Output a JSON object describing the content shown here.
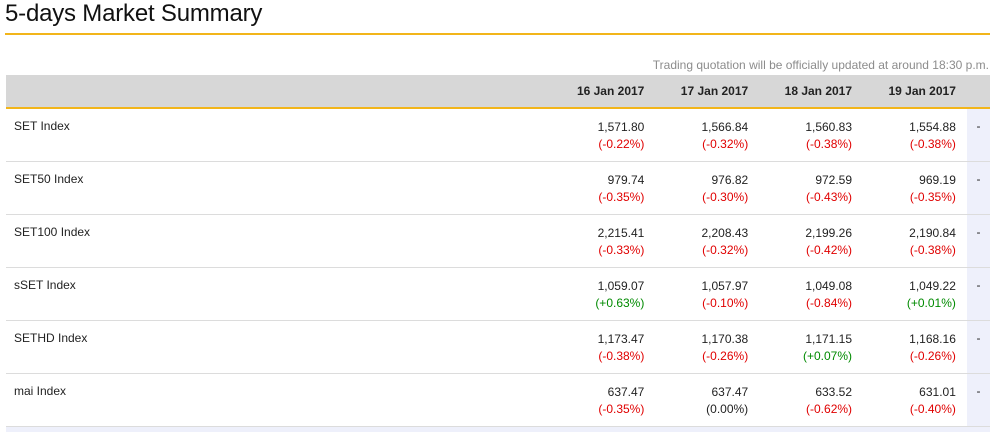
{
  "page": {
    "title": "5-days Market Summary",
    "note": "Trading quotation will be officially updated at around 18:30 p.m."
  },
  "table": {
    "dates": [
      "16 Jan 2017",
      "17 Jan 2017",
      "18 Jan 2017",
      "19 Jan 2017"
    ],
    "extra_marker": "-",
    "rows": [
      {
        "name": "SET Index",
        "values": [
          {
            "value": "1,571.80",
            "change": "(-0.22%)",
            "dir": "neg"
          },
          {
            "value": "1,566.84",
            "change": "(-0.32%)",
            "dir": "neg"
          },
          {
            "value": "1,560.83",
            "change": "(-0.38%)",
            "dir": "neg"
          },
          {
            "value": "1,554.88",
            "change": "(-0.38%)",
            "dir": "neg"
          }
        ]
      },
      {
        "name": "SET50 Index",
        "values": [
          {
            "value": "979.74",
            "change": "(-0.35%)",
            "dir": "neg"
          },
          {
            "value": "976.82",
            "change": "(-0.30%)",
            "dir": "neg"
          },
          {
            "value": "972.59",
            "change": "(-0.43%)",
            "dir": "neg"
          },
          {
            "value": "969.19",
            "change": "(-0.35%)",
            "dir": "neg"
          }
        ]
      },
      {
        "name": "SET100 Index",
        "values": [
          {
            "value": "2,215.41",
            "change": "(-0.33%)",
            "dir": "neg"
          },
          {
            "value": "2,208.43",
            "change": "(-0.32%)",
            "dir": "neg"
          },
          {
            "value": "2,199.26",
            "change": "(-0.42%)",
            "dir": "neg"
          },
          {
            "value": "2,190.84",
            "change": "(-0.38%)",
            "dir": "neg"
          }
        ]
      },
      {
        "name": "sSET Index",
        "values": [
          {
            "value": "1,059.07",
            "change": "(+0.63%)",
            "dir": "pos"
          },
          {
            "value": "1,057.97",
            "change": "(-0.10%)",
            "dir": "neg"
          },
          {
            "value": "1,049.08",
            "change": "(-0.84%)",
            "dir": "neg"
          },
          {
            "value": "1,049.22",
            "change": "(+0.01%)",
            "dir": "pos"
          }
        ]
      },
      {
        "name": "SETHD Index",
        "values": [
          {
            "value": "1,173.47",
            "change": "(-0.38%)",
            "dir": "neg"
          },
          {
            "value": "1,170.38",
            "change": "(-0.26%)",
            "dir": "neg"
          },
          {
            "value": "1,171.15",
            "change": "(+0.07%)",
            "dir": "pos"
          },
          {
            "value": "1,168.16",
            "change": "(-0.26%)",
            "dir": "neg"
          }
        ]
      },
      {
        "name": "mai Index",
        "values": [
          {
            "value": "637.47",
            "change": "(-0.35%)",
            "dir": "neg"
          },
          {
            "value": "637.47",
            "change": "(0.00%)",
            "dir": "zero"
          },
          {
            "value": "633.52",
            "change": "(-0.62%)",
            "dir": "neg"
          },
          {
            "value": "631.01",
            "change": "(-0.40%)",
            "dir": "neg"
          }
        ]
      }
    ]
  },
  "colors": {
    "accent": "#f2b51a",
    "negative": "#e00000",
    "positive": "#008a00",
    "header_bg": "#d7d7d7",
    "extra_column_bg": "#eef0fb"
  }
}
